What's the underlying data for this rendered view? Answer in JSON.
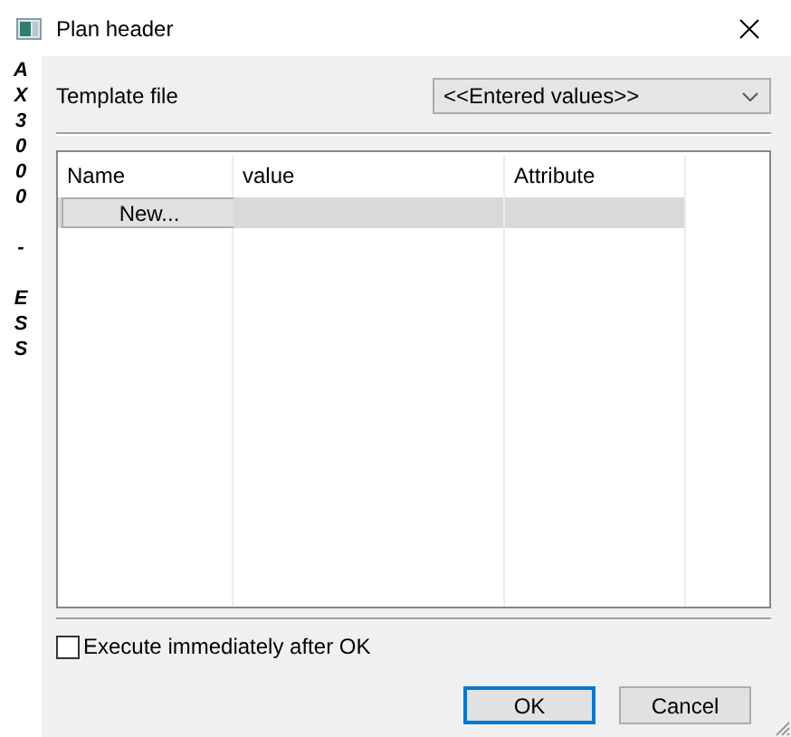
{
  "window": {
    "title": "Plan header"
  },
  "side_label": "AX3000 - ESS",
  "template_file": {
    "label": "Template file",
    "value": "<<Entered values>>"
  },
  "table": {
    "columns": [
      "Name",
      "value",
      "Attribute"
    ],
    "rows": [
      {
        "kind": "new",
        "button": "New..."
      }
    ]
  },
  "execute_option": {
    "label": "Execute immediately after OK",
    "checked": false
  },
  "buttons": [
    {
      "label": "OK",
      "default": true
    },
    {
      "label": "Cancel",
      "default": false
    }
  ]
}
